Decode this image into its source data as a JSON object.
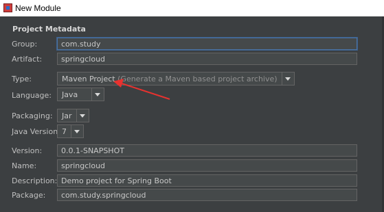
{
  "window": {
    "title": "New Module"
  },
  "section": {
    "title": "Project Metadata"
  },
  "fields": {
    "group": {
      "label": "Group:",
      "value": "com.study"
    },
    "artifact": {
      "label": "Artifact:",
      "value": "springcloud"
    },
    "type": {
      "label": "Type:",
      "value": "Maven Project",
      "hint": "(Generate a Maven based project archive)"
    },
    "language": {
      "label": "Language:",
      "value": "Java"
    },
    "packaging": {
      "label": "Packaging:",
      "value": "Jar"
    },
    "java_version": {
      "label": "Java Version:",
      "value": "7"
    },
    "version": {
      "label": "Version:",
      "value": "0.0.1-SNAPSHOT"
    },
    "name": {
      "label": "Name:",
      "value": "springcloud"
    },
    "description": {
      "label": "Description:",
      "value": "Demo project for Spring Boot"
    },
    "package": {
      "label": "Package:",
      "value": "com.study.springcloud"
    }
  },
  "colors": {
    "background": "#3c3f41",
    "field_bg": "#45494a",
    "annotation_arrow": "#e8322f",
    "focus_border": "#4a73a5"
  }
}
